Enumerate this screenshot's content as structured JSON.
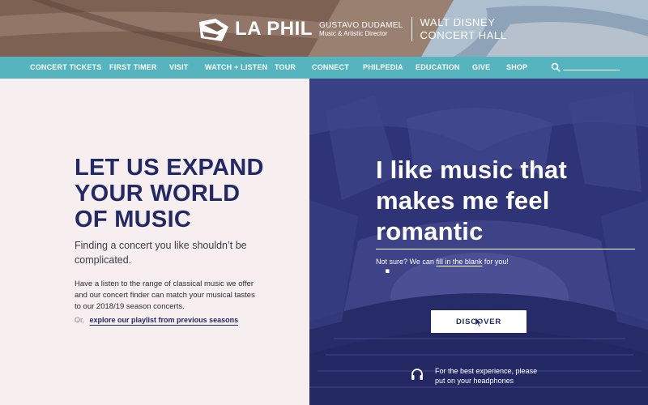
{
  "header": {
    "logo_text": "LA PHIL",
    "director_name": "GUSTAVO DUDAMEL",
    "director_title": "Music & Artistic Director",
    "hall_line1": "WALT DISNEY",
    "hall_line2": "CONCERT HALL"
  },
  "nav": {
    "items": [
      {
        "label": "CONCERT TICKETS"
      },
      {
        "label": "FIRST TIMER"
      },
      {
        "label": "VISIT"
      },
      {
        "label": "WATCH + LISTEN"
      },
      {
        "label": "TOUR"
      },
      {
        "label": "CONNECT"
      },
      {
        "label": "PHILPEDIA"
      },
      {
        "label": "EDUCATION"
      },
      {
        "label": "GIVE"
      },
      {
        "label": "SHOP"
      }
    ],
    "search_icon": "search-icon"
  },
  "left": {
    "headline_line1": "LET US EXPAND",
    "headline_line2": "YOUR WORLD",
    "headline_line3": "OF MUSIC",
    "subheading": "Finding a concert you like shouldn’t be complicated.",
    "body": "Have a listen to the range of classical music we offer and our concert finder can match your musical tastes to our 2018/19 season concerts.",
    "or_label": "Or,",
    "playlist_link": "explore our playlist from previous seasons"
  },
  "right": {
    "statement_line1": "I like music that",
    "statement_line2": "makes me feel",
    "mood_value": "romantic",
    "period": ".",
    "hint_prefix": "Not sure? We can ",
    "hint_link": "fill in the blank",
    "hint_suffix": " for you!",
    "discover_label": "DISCOVER",
    "experience_line1": "For the best experience, please",
    "experience_line2": "put on your headphones"
  },
  "colors": {
    "nav_bg": "#55b4be",
    "headline": "#232963",
    "right_panel": "#2f3476",
    "left_panel": "#f7efef"
  }
}
